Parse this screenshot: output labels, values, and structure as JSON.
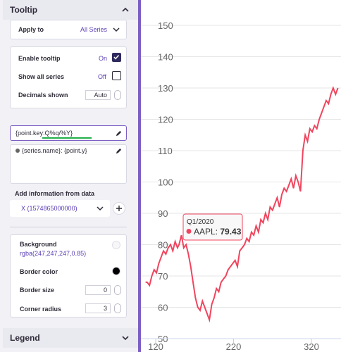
{
  "panel": {
    "tooltip_header": "Tooltip",
    "apply_to_label": "Apply to",
    "apply_to_value": "All Series",
    "enable_tooltip_label": "Enable tooltip",
    "enable_tooltip_value": "On",
    "show_all_series_label": "Show all series",
    "show_all_series_value": "Off",
    "decimals_label": "Decimals shown",
    "decimals_value": "Auto",
    "header_format": "{point.key:Q%q/%Y}",
    "point_format": "{series.name}: {point.y}",
    "add_info_label": "Add information from data",
    "add_info_value": "X (1574865000000)",
    "background_label": "Background",
    "background_value": "rgba(247,247,247,0.85)",
    "border_color_label": "Border color",
    "border_size_label": "Border size",
    "border_size_value": "0",
    "corner_radius_label": "Corner radius",
    "corner_radius_value": "3",
    "legend_header": "Legend"
  },
  "colors": {
    "accent": "#7b5fc4",
    "series": "#f0455e",
    "checkbox_on": "#2e2a5e",
    "underline": "#22b04a"
  },
  "chart_data": {
    "type": "line",
    "series": [
      {
        "name": "AAPL",
        "x": [
          107,
          109,
          112,
          115,
          118,
          121,
          124,
          127,
          130,
          133,
          136,
          139,
          142,
          145,
          148,
          150,
          153,
          156,
          159,
          162,
          165,
          168,
          171,
          174,
          177,
          180,
          183,
          186,
          189,
          192,
          195,
          198,
          201,
          204,
          207,
          210,
          213,
          216,
          219,
          222,
          225,
          228,
          231,
          234,
          237,
          240,
          243,
          246,
          249,
          252,
          255,
          258,
          261,
          264,
          267,
          270,
          273,
          276,
          279,
          282,
          285,
          288,
          291,
          294,
          297,
          300,
          303,
          306,
          309,
          312,
          315,
          318,
          321,
          324,
          327,
          330,
          333,
          336,
          339,
          342,
          345,
          348,
          351,
          354
        ],
        "values": [
          68,
          68,
          67,
          70,
          72,
          71,
          74,
          76,
          78,
          77,
          79,
          80,
          78,
          81,
          79,
          80,
          83,
          79,
          80,
          77,
          73,
          68,
          63,
          60,
          59,
          62,
          60,
          58,
          56,
          61,
          63,
          66,
          65,
          68,
          69,
          70,
          72,
          73,
          74,
          75,
          73,
          78,
          79,
          80,
          82,
          81,
          84,
          83,
          86,
          84,
          88,
          87,
          90,
          88,
          92,
          91,
          93,
          95,
          92,
          96,
          98,
          97,
          99,
          101,
          98,
          102,
          100,
          97,
          110,
          115,
          113,
          117,
          116,
          118,
          117,
          120,
          122,
          124,
          126,
          125,
          128,
          130,
          128,
          130
        ]
      }
    ],
    "tooltip": {
      "title": "Q1/2020",
      "series": "AAPL",
      "value": "79.43"
    },
    "x_ticks": [
      "120",
      "220",
      "320"
    ],
    "y_ticks": [
      "50",
      "60",
      "70",
      "80",
      "90",
      "100",
      "110",
      "120",
      "130",
      "140",
      "150"
    ],
    "ylim": [
      50,
      150
    ],
    "xlim": [
      101,
      358
    ],
    "grid": true
  }
}
